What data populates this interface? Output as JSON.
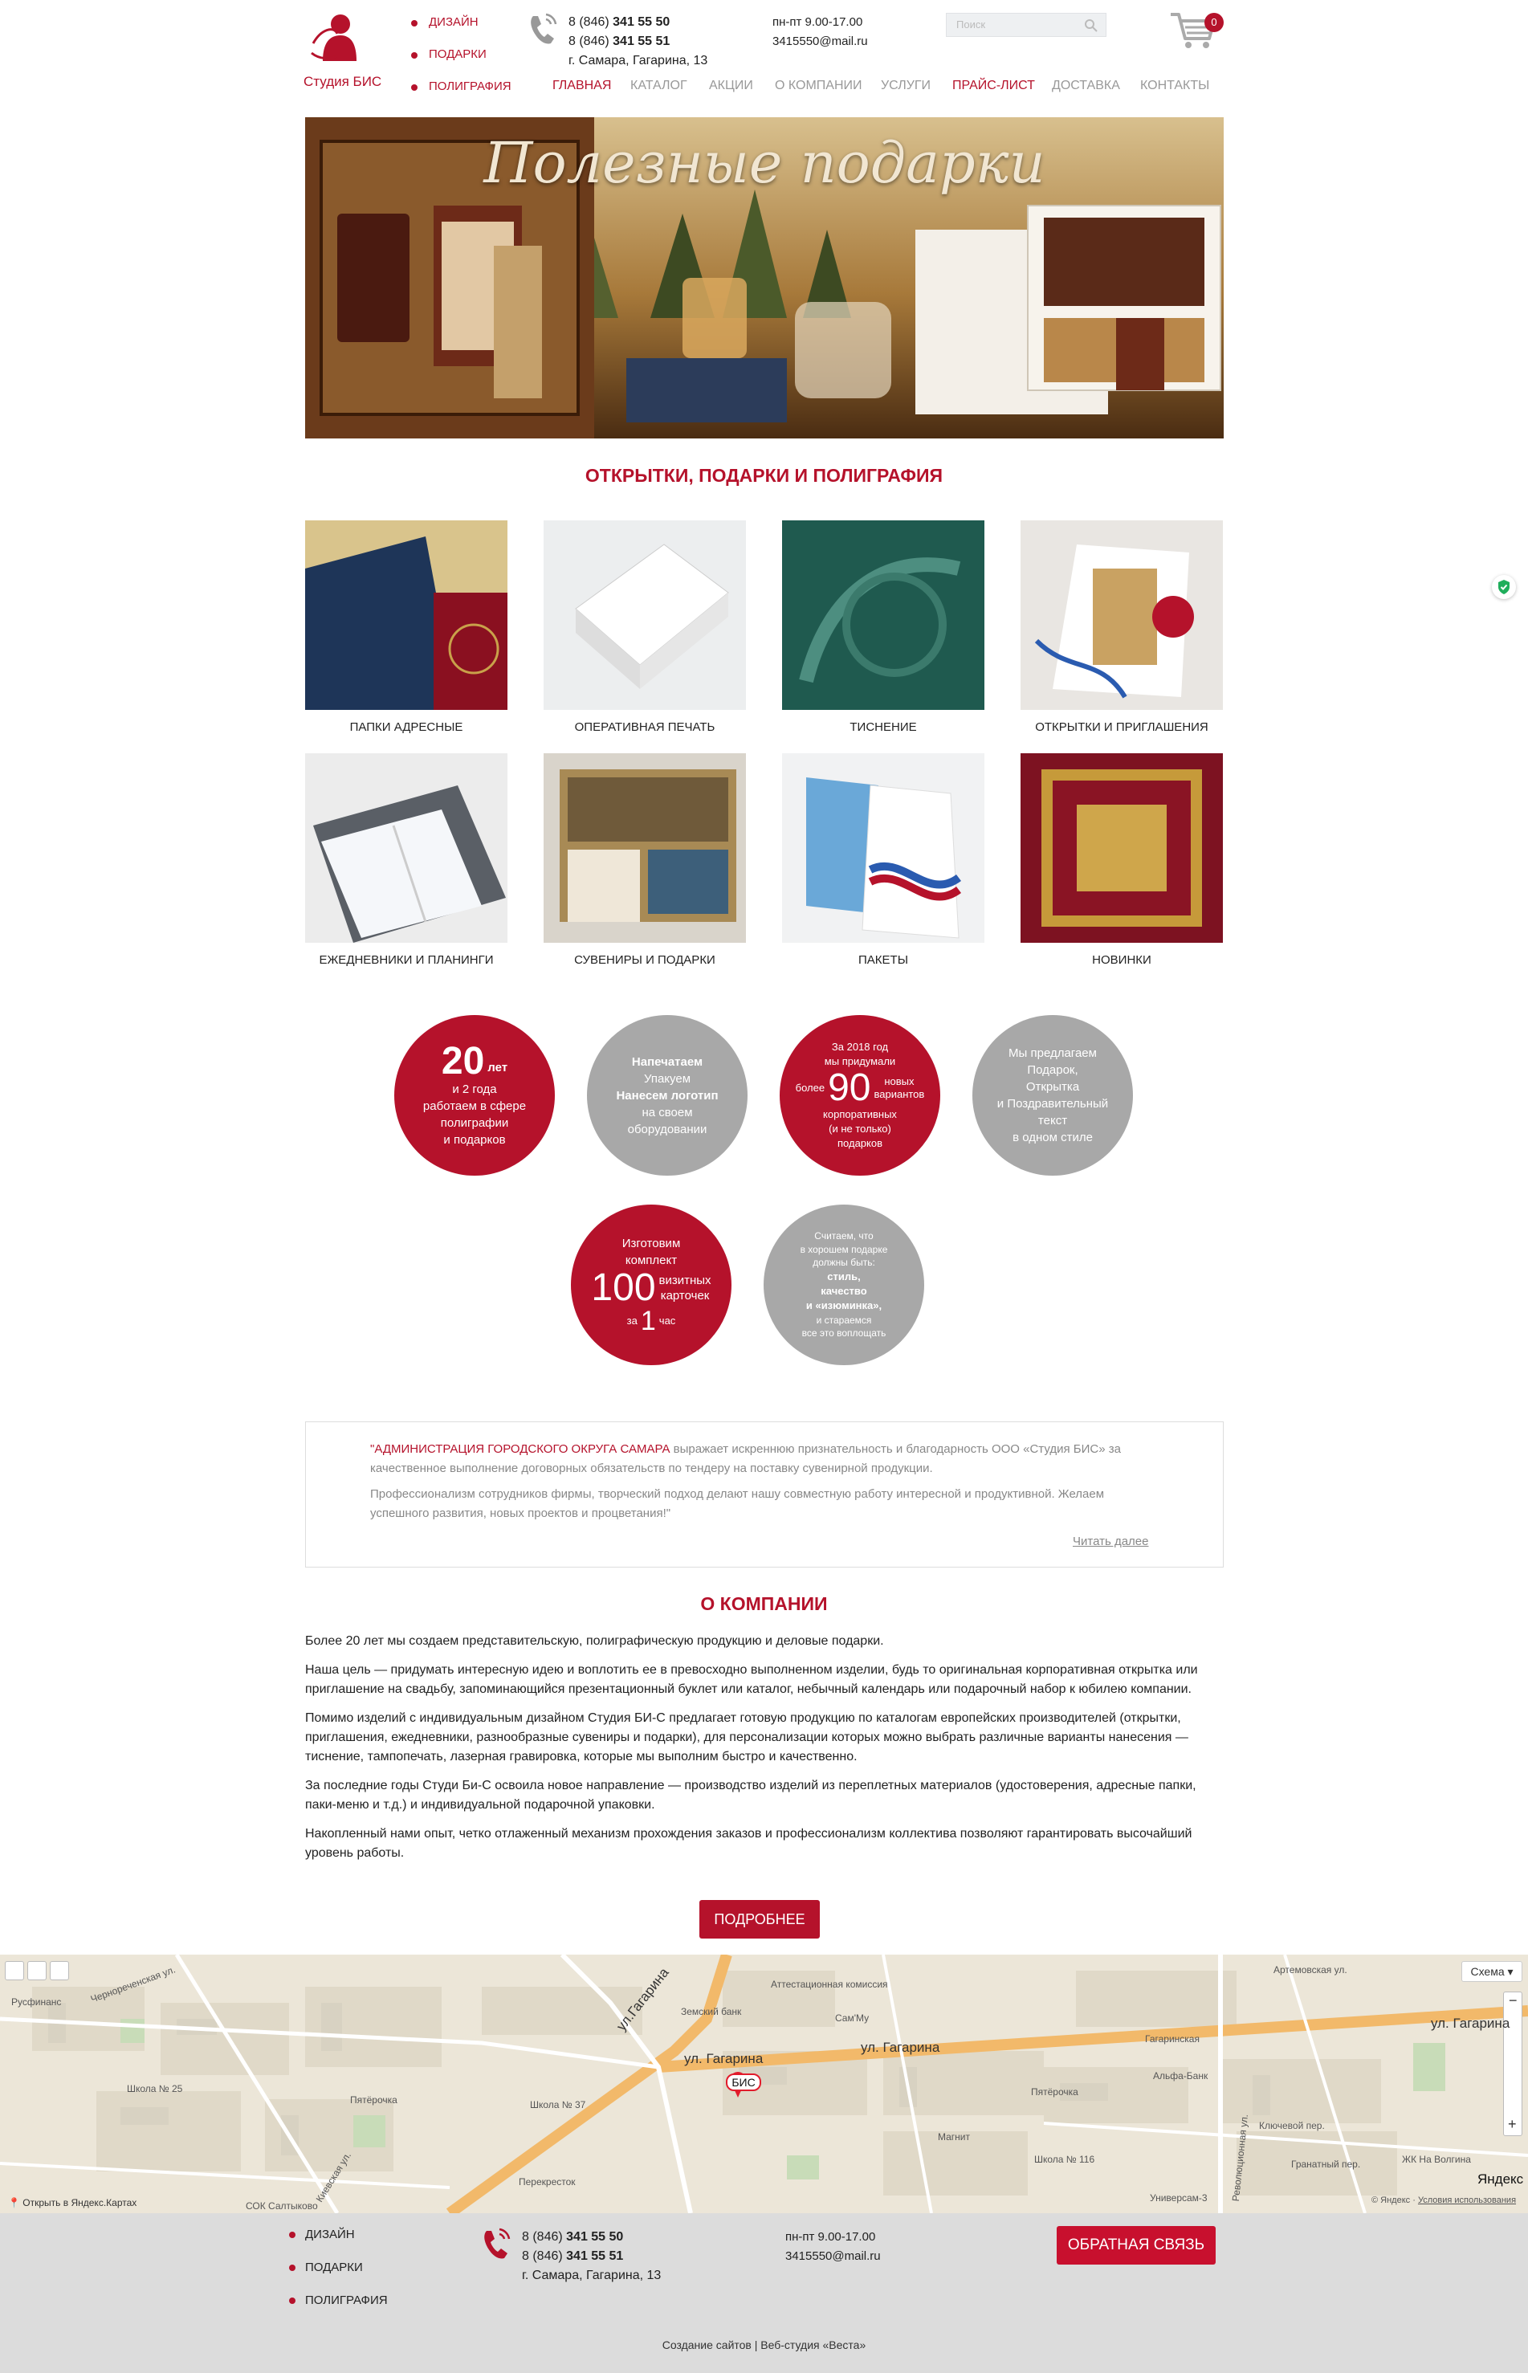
{
  "colors": {
    "accent": "#b5122b",
    "gray_circle": "#a8a8a8",
    "footer_bg": "#dcdcdc"
  },
  "header": {
    "logo_text": "Студия БИС",
    "side_links": [
      "ДИЗАЙН",
      "ПОДАРКИ",
      "ПОЛИГРАФИЯ"
    ],
    "phone1_prefix": "8 (846) ",
    "phone1_number": "341 55 50",
    "phone2_prefix": "8 (846) ",
    "phone2_number": "341 55 51",
    "address": "г. Самара, Гагарина, 13",
    "hours": "пн-пт 9.00-17.00",
    "email": "3415550@mail.ru",
    "search_placeholder": "Поиск",
    "cart_count": "0"
  },
  "nav": [
    {
      "label": "ГЛАВНАЯ",
      "active": true
    },
    {
      "label": "КАТАЛОГ"
    },
    {
      "label": "АКЦИИ"
    },
    {
      "label": "О КОМПАНИИ"
    },
    {
      "label": "УСЛУГИ"
    },
    {
      "label": "ПРАЙС-ЛИСТ",
      "active": true
    },
    {
      "label": "ДОСТАВКА"
    },
    {
      "label": "КОНТАКТЫ"
    }
  ],
  "banner": {
    "title": "Полезные подарки"
  },
  "catalog": {
    "title": "ОТКРЫТКИ, ПОДАРКИ И ПОЛИГРАФИЯ",
    "items": [
      "ПАПКИ АДРЕСНЫЕ",
      "ОПЕРАТИВНАЯ ПЕЧАТЬ",
      "ТИСНЕНИЕ",
      "ОТКРЫТКИ И ПРИГЛАШЕНИЯ",
      "ЕЖЕДНЕВНИКИ И ПЛАНИНГИ",
      "СУВЕНИРЫ И ПОДАРКИ",
      "ПАКЕТЫ",
      "НОВИНКИ"
    ]
  },
  "circles": {
    "c1": {
      "big": "20",
      "unit": "лет",
      "lines": [
        "и 2 года",
        "работаем в сфере",
        "полиграфии",
        "и подарков"
      ]
    },
    "c2": {
      "lines": [
        "Напечатаем",
        "Упакуем",
        "Нанесем логотип",
        "на своем",
        "оборудовании"
      ]
    },
    "c3": {
      "top": [
        "За 2018 год",
        "мы придумали"
      ],
      "pre": "более",
      "big": "90",
      "post1": "новых",
      "post2": "вариантов",
      "bottom": [
        "корпоративных",
        "(и не только)",
        "подарков"
      ]
    },
    "c4": {
      "lines": [
        "Мы предлагаем",
        "Подарок,",
        "Открытка",
        "и Поздравительный",
        "текст",
        "в одном стиле"
      ]
    },
    "c5": {
      "top": [
        "Изготовим",
        "комплект"
      ],
      "big": "100",
      "post1": "визитных",
      "post2": "карточек",
      "pre2": "за",
      "big2": "1",
      "post3": "час"
    },
    "c6": {
      "lines": [
        "Считаем, что",
        "в хорошем подарке",
        "должны быть:"
      ],
      "bold": [
        "стиль,",
        "качество",
        "и «изюминка»,"
      ],
      "tail": [
        "и стараемся",
        "все это воплощать"
      ]
    }
  },
  "review": {
    "org": "\"АДМИНИСТРАЦИЯ ГОРОДСКОГО ОКРУГА САМАРА",
    "text1": " выражает искреннюю признательность и благодарность ООО «Студия БИС» за качественное выполнение договорных обязательств по тендеру на поставку сувенирной продукции.",
    "text2": "Профессионализм сотрудников фирмы, творческий подход делают нашу совместную работу интересной и продуктивной. Желаем успешного развития, новых проектов и процветания!\"",
    "read_more": "Читать далее"
  },
  "about": {
    "title": "О КОМПАНИИ",
    "paragraphs": [
      "Более 20 лет мы создаем представительскую, полиграфическую продукцию и деловые подарки.",
      "Наша цель — придумать интересную идею и воплотить ее в превосходно выполненном изделии, будь то оригинальная корпоративная открытка или приглашение на свадьбу, запоминающийся презентационный буклет или каталог, небычный календарь или подарочный набор к юбилею компании.",
      "Помимо изделий с индивидуальным дизайном Студия БИ-С предлагает готовую продукцию по каталогам европейских производителей (открытки, приглашения, ежедневники, разнообразные сувениры и подарки), для персонализации которых можно выбрать различные варианты нанесения — тиснение, тампопечать, лазерная гравировка, которые мы выполним быстро и качественно.",
      "За последние годы Студи Би-С освоила новое направление — производство изделий из переплетных материалов (удостоверения, адресные папки, паки-меню и т.д.) и индивидуальной подарочной упаковки.",
      "Накопленный нами опыт, четко отлаженный механизм прохождения заказов и профессионализм коллектива позволяют гарантировать высочайший уровень работы."
    ],
    "button": "ПОДРОБНЕЕ"
  },
  "map": {
    "scheme": "Схема",
    "marker": "БИС",
    "open_link": "Открыть в Яндекс.Картах",
    "copyright": "© Яндекс",
    "terms": "Условия использования",
    "brand": "Яндекс",
    "streets": [
      "ул. Гагарина",
      "ул. Гагарина",
      "ул.Гагарина",
      "ул. Гагарина"
    ],
    "labels": [
      "Русфинанс",
      "Чернореченская ул.",
      "Школа № 25",
      "Пятёрочка",
      "Школа № 37",
      "Перекресток",
      "Земский банк",
      "Аттестационная комиссия",
      "Сам'Му",
      "Гагаринская",
      "Альфа-Банк",
      "Магнит",
      "Школа № 116",
      "Универсам-3",
      "Гранатный пер.",
      "ЖК На Волгина",
      "Ключевой пер.",
      "Пятёрочка",
      "Артемовская ул.",
      "Революционная ул.",
      "Киевская ул.",
      "СОК Салтыково"
    ]
  },
  "footer": {
    "links": [
      "ДИЗАЙН",
      "ПОДАРКИ",
      "ПОЛИГРАФИЯ"
    ],
    "phone1_prefix": "8 (846) ",
    "phone1_number": "341 55 50",
    "phone2_prefix": "8 (846) ",
    "phone2_number": "341 55 51",
    "address": "г. Самара, Гагарина, 13",
    "hours": "пн-пт 9.00-17.00",
    "email": "3415550@mail.ru",
    "feedback_button": "ОБРАТНАЯ СВЯЗЬ",
    "credits": "Создание сайтов | Веб-студия «Веста»"
  }
}
